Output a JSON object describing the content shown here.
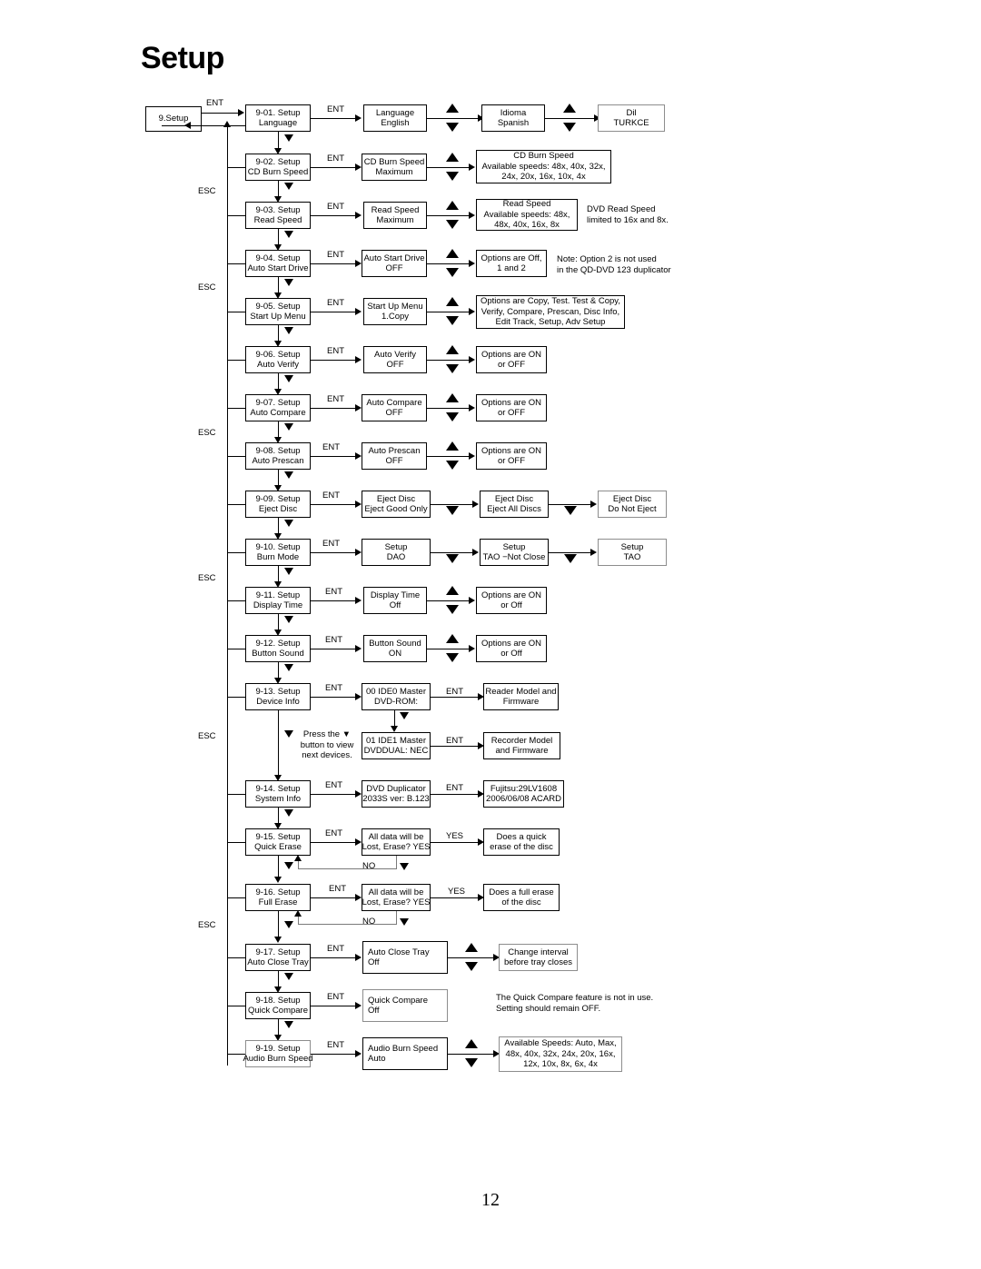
{
  "document": {
    "title": "Setup",
    "page_number": "12"
  },
  "start": {
    "label": "9.Setup"
  },
  "edge_labels": {
    "ent": "ENT",
    "esc": "ESC",
    "yes": "YES",
    "no": "NO"
  },
  "device_info_hint": "Press the ▼\nbutton to view\nnext devices.",
  "rows": [
    {
      "id": "9-01",
      "menu": [
        "9-01. Setup",
        "Language"
      ],
      "screen": [
        "Language",
        "English"
      ],
      "options": [
        [
          "Idioma",
          "Spanish"
        ],
        [
          "Dil",
          "TURKCE"
        ]
      ],
      "note": ""
    },
    {
      "id": "9-02",
      "menu": [
        "9-02.  Setup",
        "CD Burn Speed"
      ],
      "screen": [
        "CD Burn Speed",
        "Maximum"
      ],
      "options": [
        [
          "CD Burn Speed",
          "Available speeds: 48x, 40x, 32x,",
          "24x, 20x, 16x, 10x, 4x"
        ]
      ],
      "note": ""
    },
    {
      "id": "9-03",
      "menu": [
        "9-03. Setup",
        "Read Speed"
      ],
      "screen": [
        "Read Speed",
        "Maximum"
      ],
      "options": [
        [
          "Read Speed",
          "Available speeds: 48x,",
          "48x, 40x, 16x, 8x"
        ]
      ],
      "note": "DVD Read Speed\nlimited to 16x and 8x."
    },
    {
      "id": "9-04",
      "menu": [
        "9-04. Setup",
        "Auto Start Drive"
      ],
      "screen": [
        "Auto Start Drive",
        "OFF"
      ],
      "options": [
        [
          "Options are Off,",
          "1 and 2"
        ]
      ],
      "note": "Note: Option 2 is not used\nin the QD-DVD 123 duplicator"
    },
    {
      "id": "9-05",
      "menu": [
        "9-05. Setup",
        "Start Up Menu"
      ],
      "screen": [
        "Start Up Menu",
        "1.Copy"
      ],
      "options": [
        [
          "Options are Copy, Test. Test & Copy,",
          "Verify, Compare, Prescan, Disc Info,",
          "Edit Track, Setup, Adv Setup"
        ]
      ],
      "note": ""
    },
    {
      "id": "9-06",
      "menu": [
        "9-06. Setup",
        "Auto Verify"
      ],
      "screen": [
        "Auto Verify",
        "OFF"
      ],
      "options": [
        [
          "Options are ON",
          "or OFF"
        ]
      ],
      "note": ""
    },
    {
      "id": "9-07",
      "menu": [
        "9-07. Setup",
        "Auto Compare"
      ],
      "screen": [
        "Auto Compare",
        "OFF"
      ],
      "options": [
        [
          "Options are ON",
          "or OFF"
        ]
      ],
      "note": ""
    },
    {
      "id": "9-08",
      "menu": [
        "9-08. Setup",
        "Auto Prescan"
      ],
      "screen": [
        "Auto Prescan",
        "OFF"
      ],
      "options": [
        [
          "Options are ON",
          "or OFF"
        ]
      ],
      "note": ""
    },
    {
      "id": "9-09",
      "menu": [
        "9-09. Setup",
        "Eject Disc"
      ],
      "screen": [
        "Eject Disc",
        "Eject Good Only"
      ],
      "options": [
        [
          "Eject Disc",
          "Eject All Discs"
        ],
        [
          "Eject Disc",
          "Do Not Eject"
        ]
      ],
      "note": ""
    },
    {
      "id": "9-10",
      "menu": [
        "9-10. Setup",
        "Burn Mode"
      ],
      "screen": [
        "Setup",
        "DAO"
      ],
      "options": [
        [
          "Setup",
          "TAO −Not Close"
        ],
        [
          "Setup",
          "TAO"
        ]
      ],
      "note": ""
    },
    {
      "id": "9-11",
      "menu": [
        "9-11. Setup",
        "Display Time"
      ],
      "screen": [
        "Display Time",
        "Off"
      ],
      "options": [
        [
          "Options are ON",
          "or Off"
        ]
      ],
      "note": ""
    },
    {
      "id": "9-12",
      "menu": [
        "9-12. Setup",
        "Button Sound"
      ],
      "screen": [
        "Button Sound",
        "ON"
      ],
      "options": [
        [
          "Options are ON",
          "or Off"
        ]
      ],
      "note": ""
    },
    {
      "id": "9-13",
      "menu": [
        "9-13. Setup",
        "Device Info"
      ],
      "screen": [
        "00 IDE0 Master",
        "DVD-ROM:"
      ],
      "options": [
        [
          "Reader Model and",
          "Firmware"
        ]
      ],
      "sub_screen": [
        "01 IDE1 Master",
        "DVDDUAL: NEC"
      ],
      "sub_options": [
        [
          "Recorder Model",
          "and Firmware"
        ]
      ],
      "note": ""
    },
    {
      "id": "9-14",
      "menu": [
        "9-14. Setup",
        "System Info"
      ],
      "screen": [
        "DVD Duplicator",
        "2033S ver: B.123"
      ],
      "options": [
        [
          "Fujitsu:29LV1608",
          "2006/06/08 ACARD"
        ]
      ],
      "note": ""
    },
    {
      "id": "9-15",
      "menu": [
        "9-15. Setup",
        "Quick Erase"
      ],
      "screen": [
        "All data will be",
        "Lost, Erase? YES"
      ],
      "options": [
        [
          "Does a quick",
          "erase of the disc"
        ]
      ],
      "note": ""
    },
    {
      "id": "9-16",
      "menu": [
        "9-16. Setup",
        "Full Erase"
      ],
      "screen": [
        "All data will be",
        "Lost, Erase? YES"
      ],
      "options": [
        [
          "Does a full erase",
          "of the disc"
        ]
      ],
      "note": ""
    },
    {
      "id": "9-17",
      "menu": [
        "9-17. Setup",
        "Auto Close Tray"
      ],
      "screen": [
        "Auto Close Tray",
        "Off"
      ],
      "options": [
        [
          "Change interval",
          "before tray closes"
        ]
      ],
      "note": ""
    },
    {
      "id": "9-18",
      "menu": [
        "9-18. Setup",
        "Quick Compare"
      ],
      "screen": [
        "Quick Compare",
        "Off"
      ],
      "options": [],
      "note": "The Quick Compare feature is not in use.\nSetting should remain OFF."
    },
    {
      "id": "9-19",
      "menu": [
        "9-19. Setup",
        "Audio Burn Speed"
      ],
      "screen": [
        "Audio Burn Speed",
        "Auto"
      ],
      "options": [
        [
          "Available Speeds: Auto, Max,",
          "48x, 40x, 32x, 24x, 20x, 16x,",
          "12x, 10x, 8x, 6x, 4x"
        ]
      ],
      "note": ""
    }
  ]
}
